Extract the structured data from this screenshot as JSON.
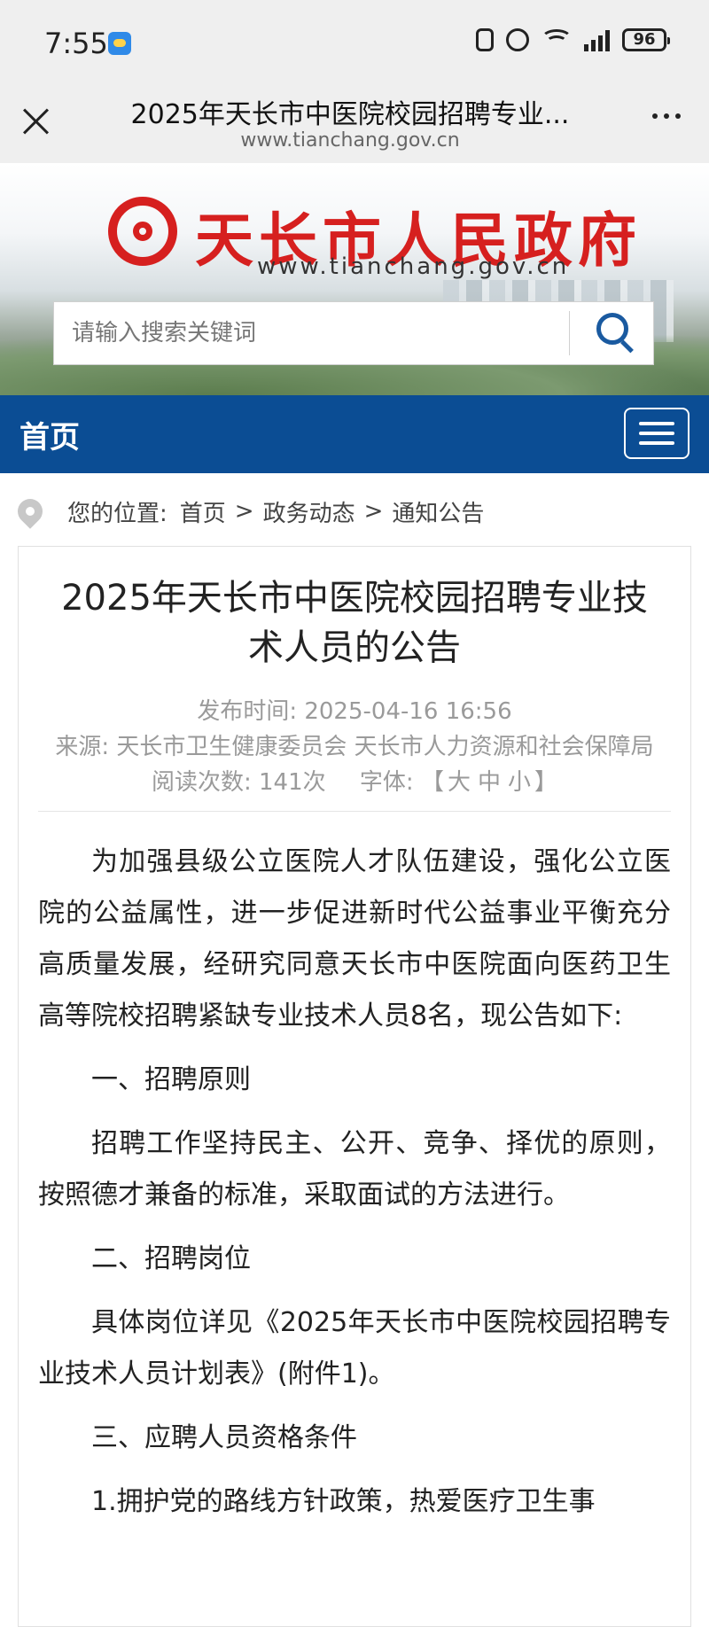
{
  "status_bar": {
    "time": "7:55",
    "battery": "96"
  },
  "browser": {
    "title": "2025年天长市中医院校园招聘专业...",
    "url": "www.tianchang.gov.cn"
  },
  "banner": {
    "site_name": "天长市人民政府",
    "site_domain": "www.tianchang.gov.cn",
    "search_placeholder": "请输入搜索关键词"
  },
  "nav": {
    "home": "首页"
  },
  "breadcrumb": {
    "label": "您的位置:",
    "items": [
      "首页",
      "政务动态",
      "通知公告"
    ],
    "separator": ">"
  },
  "article": {
    "title": "2025年天长市中医院校园招聘专业技术人员的公告",
    "publish_time": "发布时间: 2025-04-16 16:56",
    "source": "来源: 天长市卫生健康委员会 天长市人力资源和社会保障局",
    "read_count": "阅读次数: 141次",
    "font_label": "字体:",
    "font_open": "【",
    "font_large": "大",
    "font_medium": "中",
    "font_small": "小",
    "font_close": "】",
    "paragraphs": [
      "为加强县级公立医院人才队伍建设，强化公立医院的公益属性，进一步促进新时代公益事业平衡充分高质量发展，经研究同意天长市中医院面向医药卫生高等院校招聘紧缺专业技术人员8名，现公告如下:",
      "一、招聘原则",
      "招聘工作坚持民主、公开、竞争、择优的原则，按照德才兼备的标准，采取面试的方法进行。",
      "二、招聘岗位",
      "具体岗位详见《2025年天长市中医院校园招聘专业技术人员计划表》(附件1)。",
      "三、应聘人员资格条件",
      "1.拥护党的路线方针政策，热爱医疗卫生事"
    ]
  }
}
